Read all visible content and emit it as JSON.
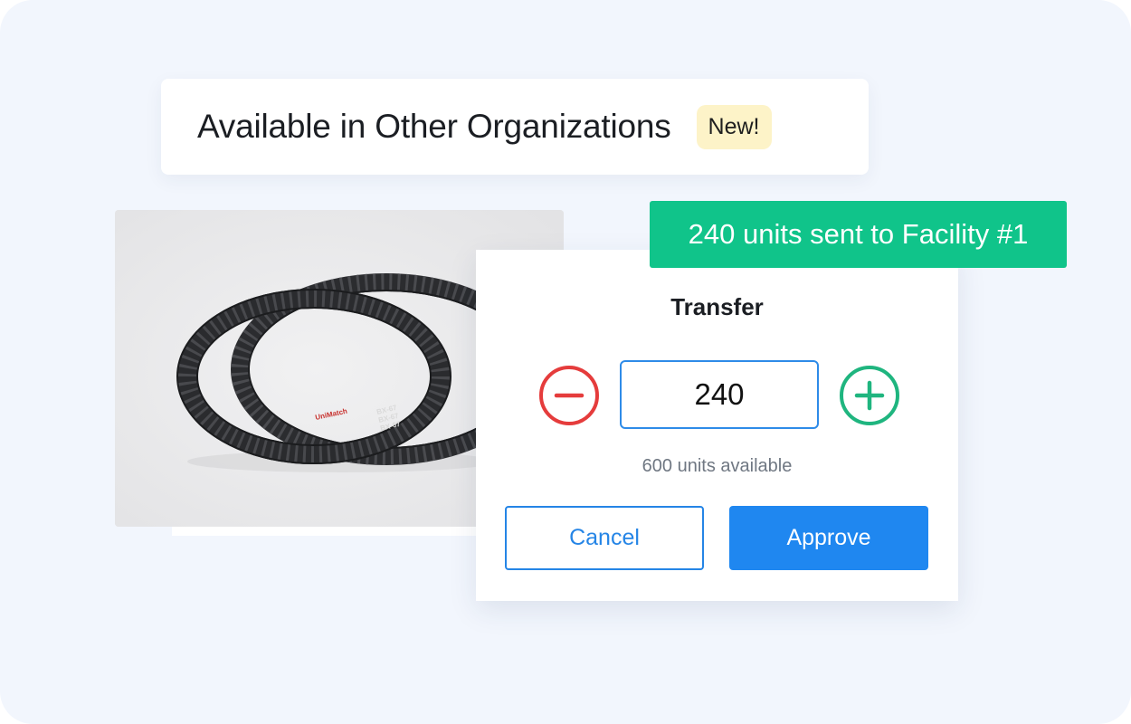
{
  "header": {
    "title": "Available in Other Organizations",
    "badge": "New!"
  },
  "product": {
    "image": "rubber-v-belt-photo",
    "printed_markings": [
      "BX-67",
      "UniMatch"
    ]
  },
  "transfer_dialog": {
    "title": "Transfer",
    "quantity": "240",
    "availability": "600 units available",
    "cancel_label": "Cancel",
    "approve_label": "Approve",
    "icons": {
      "decrease": "minus-circle-icon",
      "increase": "plus-circle-icon"
    }
  },
  "notification": {
    "message": "240 units sent to Facility #1"
  },
  "colors": {
    "background": "#f2f6fd",
    "badge_bg": "#fdf3c8",
    "toast_bg": "#10c48a",
    "primary": "#1f87f0",
    "decrease": "#e53c3c",
    "increase": "#1fb57f"
  }
}
